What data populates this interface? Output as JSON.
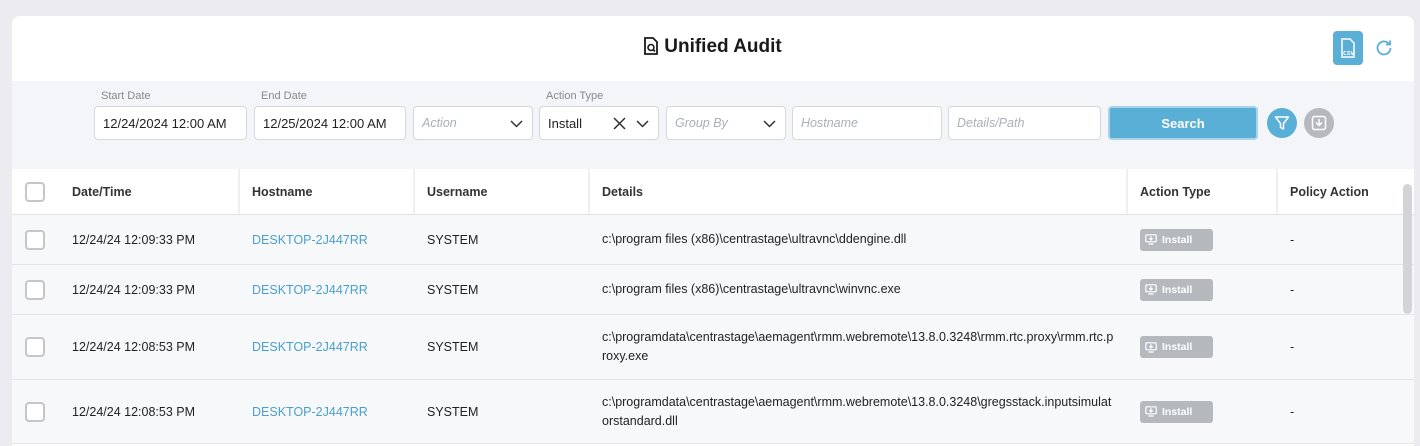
{
  "header": {
    "title": "Unified Audit",
    "csv_icon": "csv-file-icon",
    "refresh_icon": "refresh-icon"
  },
  "filters": {
    "start_date": {
      "label": "Start Date",
      "value": "12/24/2024 12:00 AM"
    },
    "end_date": {
      "label": "End Date",
      "value": "12/25/2024 12:00 AM"
    },
    "action": {
      "placeholder": "Action"
    },
    "action_type": {
      "label": "Action Type",
      "value": "Install"
    },
    "group_by": {
      "placeholder": "Group By"
    },
    "hostname": {
      "placeholder": "Hostname"
    },
    "details_path": {
      "placeholder": "Details/Path"
    },
    "search_label": "Search",
    "filter_icon": "filter-icon",
    "download_icon": "download-icon"
  },
  "table": {
    "columns": [
      "Date/Time",
      "Hostname",
      "Username",
      "Details",
      "Action Type",
      "Policy Action"
    ],
    "rows": [
      {
        "datetime": "12/24/24 12:09:33 PM",
        "hostname": "DESKTOP-2J447RR",
        "username": "SYSTEM",
        "details": "c:\\program files (x86)\\centrastage\\ultravnc\\ddengine.dll",
        "action_type": "Install",
        "policy_action": "-"
      },
      {
        "datetime": "12/24/24 12:09:33 PM",
        "hostname": "DESKTOP-2J447RR",
        "username": "SYSTEM",
        "details": "c:\\program files (x86)\\centrastage\\ultravnc\\winvnc.exe",
        "action_type": "Install",
        "policy_action": "-"
      },
      {
        "datetime": "12/24/24 12:08:53 PM",
        "hostname": "DESKTOP-2J447RR",
        "username": "SYSTEM",
        "details": "c:\\programdata\\centrastage\\aemagent\\rmm.webremote\\13.8.0.3248\\rmm.rtc.proxy\\rmm.rtc.proxy.exe",
        "action_type": "Install",
        "policy_action": "-"
      },
      {
        "datetime": "12/24/24 12:08:53 PM",
        "hostname": "DESKTOP-2J447RR",
        "username": "SYSTEM",
        "details": "c:\\programdata\\centrastage\\aemagent\\rmm.webremote\\13.8.0.3248\\gregsstack.inputsimulatorstandard.dll",
        "action_type": "Install",
        "policy_action": "-"
      }
    ]
  }
}
